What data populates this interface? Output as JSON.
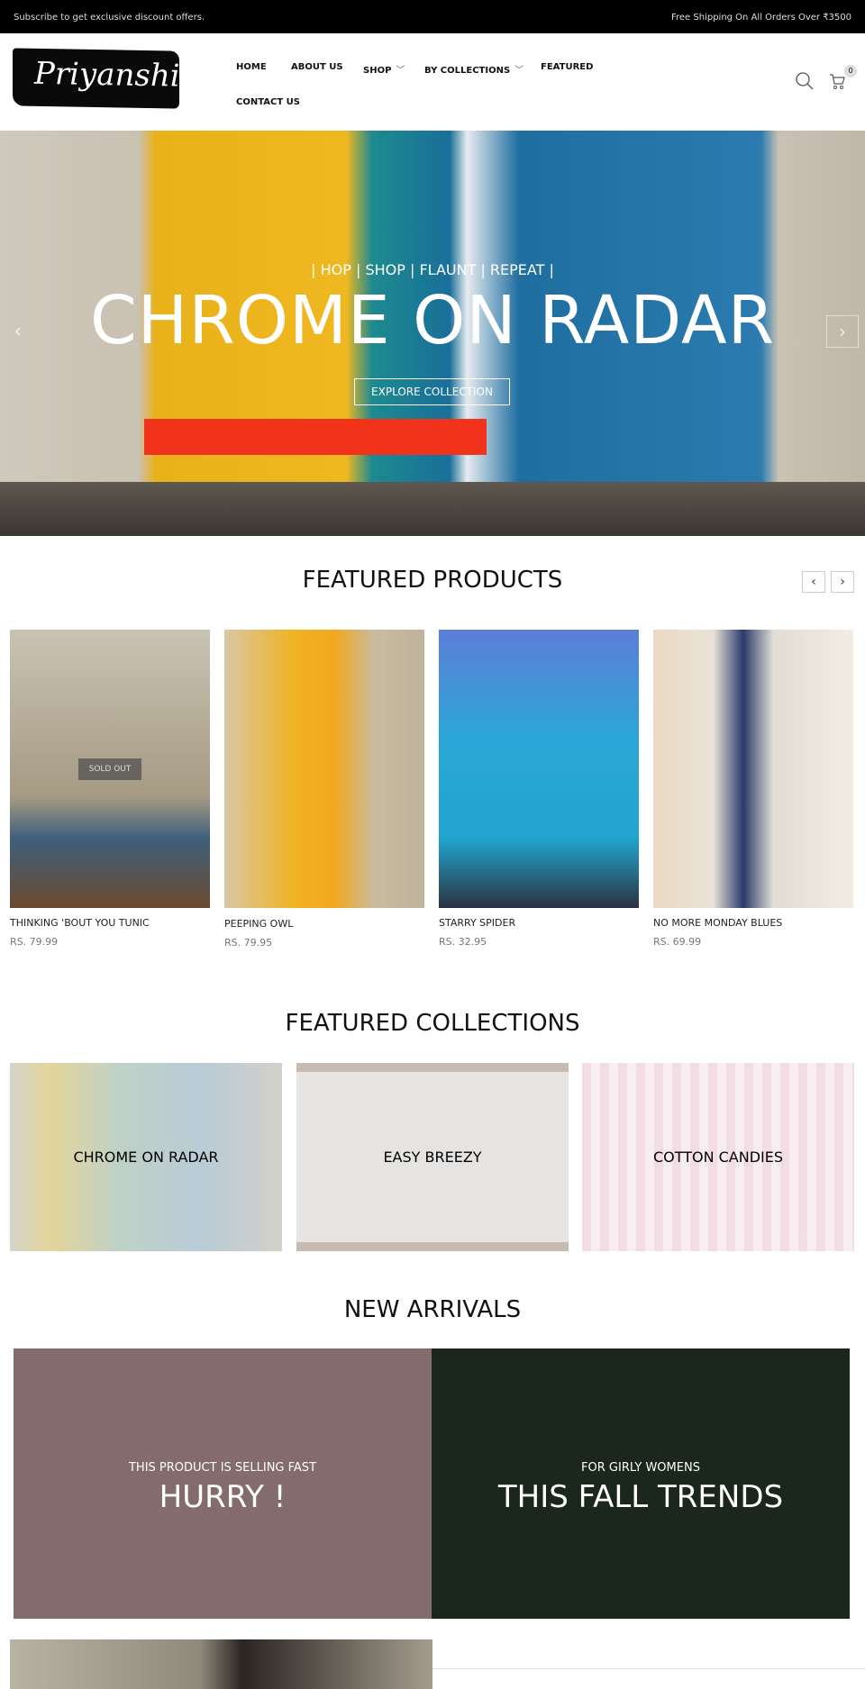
{
  "topbar": {
    "left": "Subscribe to get exclusive discount offers.",
    "right": "Free Shipping On All Orders Over ₹3500"
  },
  "header": {
    "logo": "Priyanshi",
    "nav": [
      "HOME",
      "ABOUT US",
      "SHOP",
      "BY COLLECTIONS",
      "FEATURED",
      "CONTACT US"
    ],
    "cart_count": "0"
  },
  "hero": {
    "tagline": "| HOP | SHOP | FLAUNT | REPEAT |",
    "title": "CHROME ON RADAR",
    "button": "EXPLORE COLLECTION"
  },
  "featured_products": {
    "title": "FEATURED PRODUCTS",
    "items": [
      {
        "name": "THINKING 'BOUT YOU TUNIC",
        "price": "RS. 79.99",
        "badge": "SOLD OUT"
      },
      {
        "name": "PEEPING OWL",
        "price": "RS. 79.95"
      },
      {
        "name": "STARRY SPIDER",
        "price": "RS. 32.95"
      },
      {
        "name": "NO MORE MONDAY BLUES",
        "price": "RS. 69.99"
      }
    ]
  },
  "featured_collections": {
    "title": "FEATURED COLLECTIONS",
    "items": [
      "CHROME ON RADAR",
      "EASY BREEZY",
      "COTTON CANDIES"
    ]
  },
  "new_arrivals": {
    "title": "NEW ARRIVALS",
    "banners": [
      {
        "small": "THIS PRODUCT IS SELLING FAST",
        "big": "HURRY !",
        "color": "#846b6c"
      },
      {
        "small": "FOR GIRLY WOMENS",
        "big": "THIS FALL TRENDS",
        "color": "#1b261d"
      }
    ]
  }
}
